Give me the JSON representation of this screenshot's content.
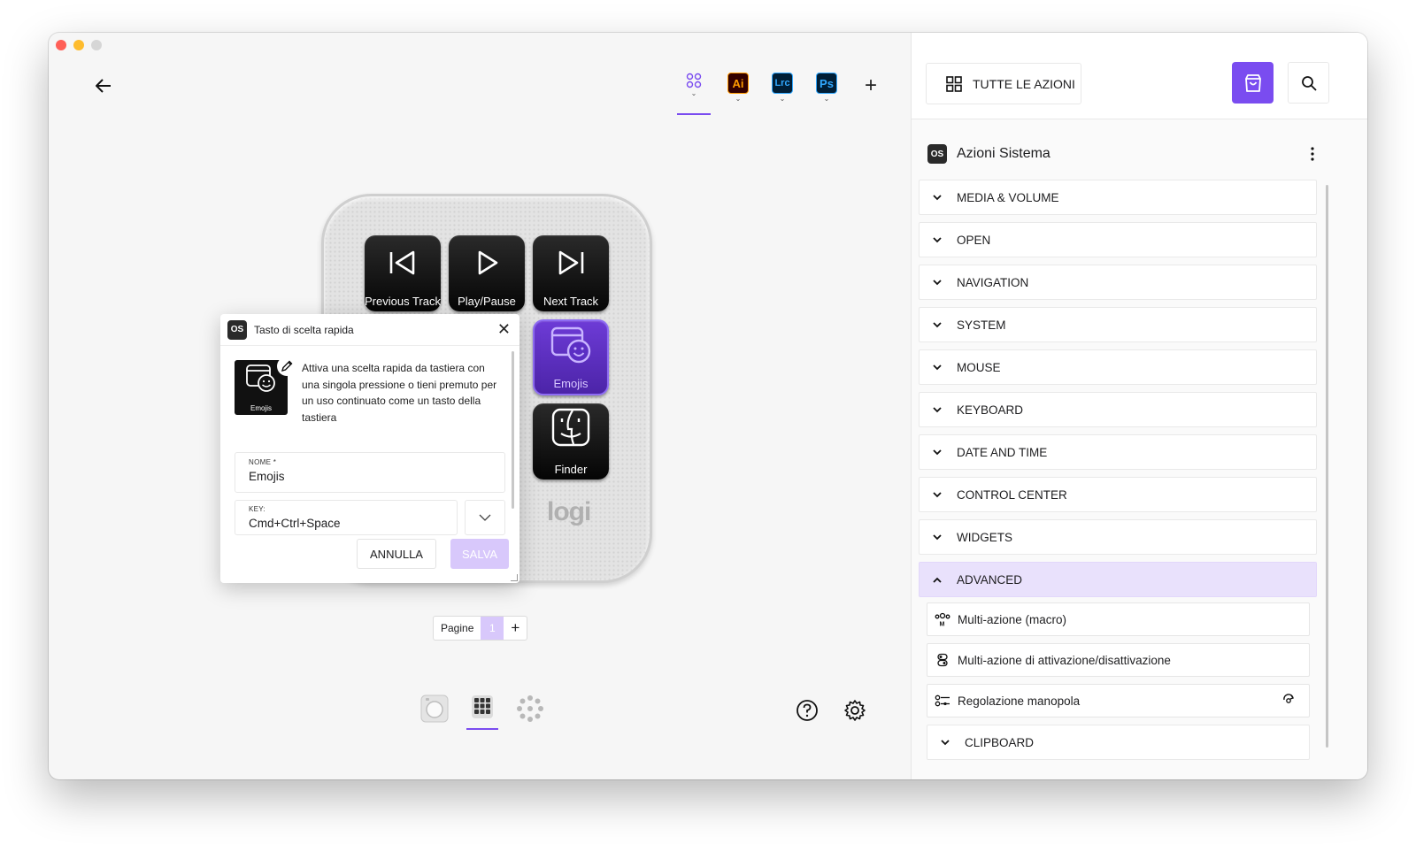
{
  "window": {
    "traffic": [
      "close",
      "minimize",
      "zoom"
    ]
  },
  "header": {
    "apps": [
      {
        "name": "all-apps",
        "label": "",
        "active": true
      },
      {
        "name": "illustrator",
        "label": "Ai"
      },
      {
        "name": "lightroom",
        "label": "Lrc"
      },
      {
        "name": "photoshop",
        "label": "Ps"
      }
    ],
    "add": "+"
  },
  "device": {
    "keys": [
      {
        "label": "Previous Track",
        "icon": "previous-track-icon"
      },
      {
        "label": "Play/Pause",
        "icon": "play-icon"
      },
      {
        "label": "Next Track",
        "icon": "next-track-icon"
      },
      {
        "label": "Emojis",
        "icon": "emoji-icon",
        "selected": true
      },
      {
        "label": "Finder",
        "icon": "finder-icon"
      }
    ],
    "brand": "logi"
  },
  "popup": {
    "badge": "OS",
    "title": "Tasto di scelta rapida",
    "thumb_label": "Emojis",
    "description": "Attiva una scelta rapida da tastiera con una singola pressione o tieni premuto per un uso continuato come un tasto della tastiera",
    "name_label": "NOME *",
    "name_value": "Emojis",
    "key_label": "KEY:",
    "key_value": "Cmd+Ctrl+Space",
    "cancel": "ANNULLA",
    "save": "SALVA"
  },
  "pages": {
    "label": "Pagine",
    "current": "1",
    "add": "+"
  },
  "panel": {
    "all_actions": "TUTTE LE AZIONI",
    "section_badge": "OS",
    "section_title": "Azioni Sistema",
    "categories": [
      "MEDIA & VOLUME",
      "OPEN",
      "NAVIGATION",
      "SYSTEM",
      "MOUSE",
      "KEYBOARD",
      "DATE AND TIME",
      "CONTROL CENTER",
      "WIDGETS"
    ],
    "advanced": {
      "label": "ADVANCED",
      "items": [
        "Multi-azione (macro)",
        "Multi-azione di attivazione/disattivazione",
        "Regolazione manopola"
      ]
    },
    "clipboard": "CLIPBOARD"
  },
  "colors": {
    "accent": "#7a4cf0",
    "accent_light": "#d8c8fb",
    "selected_key": "#5b2fc4"
  }
}
